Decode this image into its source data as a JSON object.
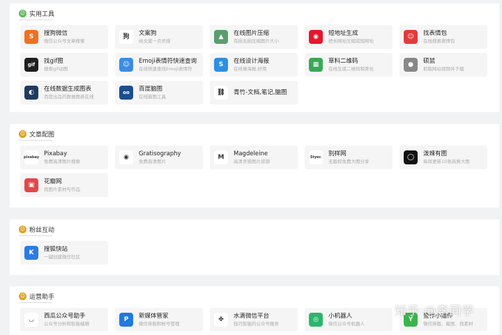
{
  "sections": [
    {
      "title": "实用工具",
      "icon": "smiley-icon",
      "icon_color": "#5cb85c",
      "items": [
        {
          "name": "搜狗微信",
          "desc": "微信公众号文章搜索",
          "icon": "sogou-icon",
          "icon_bg": "#f07022",
          "glyph": "S"
        },
        {
          "name": "文案狗",
          "desc": "给文案一点灵感",
          "icon": "wenangou-icon",
          "icon_bg": "#ffffff",
          "glyph": "狗"
        },
        {
          "name": "在线图片压缩",
          "desc": "有损无损压缩图片大小",
          "icon": "compress-icon",
          "icon_bg": "#5a9e6f",
          "glyph": "▲"
        },
        {
          "name": "短地址生成",
          "desc": "把长网址压缩成短网址",
          "icon": "weibo-icon",
          "icon_bg": "#e6162d",
          "glyph": "◉"
        },
        {
          "name": "找表情包",
          "desc": "在线搜索表情包",
          "icon": "emoji-pack-icon",
          "icon_bg": "#e23b3b",
          "glyph": "☺"
        },
        {
          "name": "找gif图",
          "desc": "搜索gif动图",
          "icon": "gif-icon",
          "icon_bg": "#1e1e1e",
          "glyph": "gif"
        },
        {
          "name": "Emoji表情符快速查询",
          "desc": "在线快速查找Emoji表情符",
          "icon": "emoji-icon",
          "icon_bg": "#3b8de0",
          "glyph": "☺"
        },
        {
          "name": "在线设计海报",
          "desc": "在线做海报,好用",
          "icon": "poster-icon",
          "icon_bg": "#2f8fe0",
          "glyph": "S"
        },
        {
          "name": "草料二维码",
          "desc": "在线生成二维码和美化",
          "icon": "qrcode-icon",
          "icon_bg": "#3aa857",
          "glyph": "▦"
        },
        {
          "name": "硕鼠",
          "desc": "抓取网站视频并下载",
          "icon": "mouse-icon",
          "icon_bg": "#888888",
          "glyph": "●"
        },
        {
          "name": "在线数据生成图表",
          "desc": "百度出品的数据图表在线",
          "icon": "echarts-icon",
          "icon_bg": "#1e3a5f",
          "glyph": "◐"
        },
        {
          "name": "百度脑图",
          "desc": "在线脑图工具",
          "icon": "baidu-brain-icon",
          "icon_bg": "#1c4d8c",
          "glyph": "oo"
        },
        {
          "name": "青竹-文档,笔记,脑图",
          "desc": "",
          "icon": "link-icon",
          "icon_bg": "#ffffff",
          "glyph": "⛓"
        }
      ]
    },
    {
      "title": "文章配图",
      "icon": "image-smiley-icon",
      "icon_color": "#e0a020",
      "items": [
        {
          "name": "Pixabay",
          "desc": "免费高清图片搜索",
          "icon": "pixabay-icon",
          "icon_bg": "#ffffff",
          "glyph": "pixabay"
        },
        {
          "name": "Gratisography",
          "desc": "免费高清图片",
          "icon": "gratisography-icon",
          "icon_bg": "#ffffff",
          "glyph": "◉"
        },
        {
          "name": "Magdeleine",
          "desc": "高清灵感图片资源",
          "icon": "magdeleine-icon",
          "icon_bg": "#ffffff",
          "glyph": "M"
        },
        {
          "name": "别样网",
          "desc": "无版权免费大图分享",
          "icon": "bieyang-icon",
          "icon_bg": "#ffffff",
          "glyph": "Styer."
        },
        {
          "name": "泼辣有图",
          "desc": "每周更新10张高质大图",
          "icon": "pola-icon",
          "icon_bg": "#111111",
          "glyph": "◯"
        },
        {
          "name": "花瓣网",
          "desc": "找图片素材与作品",
          "icon": "huaban-icon",
          "icon_bg": "#e54646",
          "glyph": "▣"
        }
      ]
    },
    {
      "title": "粉丝互动",
      "icon": "fans-smiley-icon",
      "icon_color": "#e0a020",
      "items": [
        {
          "name": "搜狐快站",
          "desc": "一键创建微信社区",
          "icon": "kuaizhan-icon",
          "icon_bg": "#2c7be5",
          "glyph": "K"
        }
      ]
    },
    {
      "title": "运营助手",
      "icon": "assistant-smiley-icon",
      "icon_color": "#e0a020",
      "items": [
        {
          "name": "西瓜公众号助手",
          "desc": "公众号分析和智能编辑",
          "icon": "xigua-icon",
          "icon_bg": "#ffffff",
          "glyph": "◡"
        },
        {
          "name": "新媒体管家",
          "desc": "微信排版和帐号管理",
          "icon": "xinmeiti-icon",
          "icon_bg": "#1f7ae0",
          "glyph": "P"
        },
        {
          "name": "水滴微信平台",
          "desc": "轻巧智能的公众号服务",
          "icon": "shuidi-icon",
          "icon_bg": "#ffffff",
          "glyph": "✤"
        },
        {
          "name": "小机器人",
          "desc": "微信公众号机器人",
          "icon": "robot-icon",
          "icon_bg": "#2db56b",
          "glyph": "◎"
        },
        {
          "name": "壹伴小插件",
          "desc": "微信排版、截图、找素材",
          "icon": "yiban-icon",
          "icon_bg": "#3bb54a",
          "glyph": "Y"
        }
      ]
    }
  ],
  "watermark": "知乎 @李同学"
}
